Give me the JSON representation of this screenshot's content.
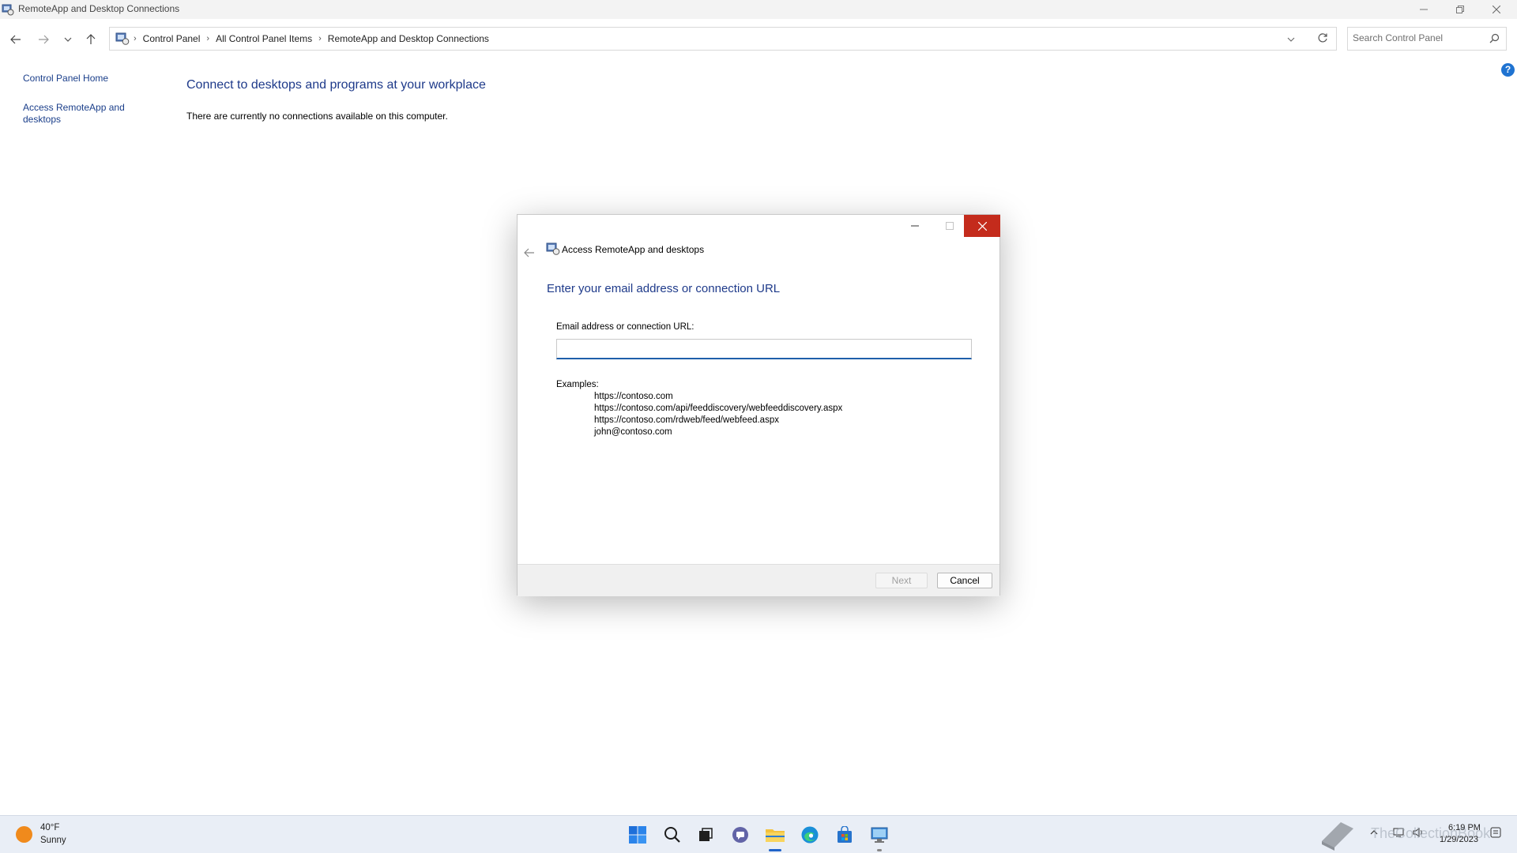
{
  "window": {
    "title": "RemoteApp and Desktop Connections"
  },
  "address": {
    "crumbs": [
      "Control Panel",
      "All Control Panel Items",
      "RemoteApp and Desktop Connections"
    ],
    "search_placeholder": "Search Control Panel"
  },
  "sidebar": {
    "items": [
      {
        "label": "Control Panel Home"
      },
      {
        "label": "Access RemoteApp and desktops"
      }
    ]
  },
  "main": {
    "heading": "Connect to desktops and programs at your workplace",
    "info": "There are currently no connections available on this computer.",
    "help_label": "?"
  },
  "dialog": {
    "title": "Access RemoteApp and desktops",
    "heading": "Enter your email address or connection URL",
    "field_label": "Email address or connection URL:",
    "field_value": "",
    "examples_label": "Examples:",
    "examples": [
      "https://contoso.com",
      "https://contoso.com/api/feeddiscovery/webfeeddiscovery.aspx",
      "https://contoso.com/rdweb/feed/webfeed.aspx",
      "john@contoso.com"
    ],
    "next_label": "Next",
    "cancel_label": "Cancel"
  },
  "taskbar": {
    "weather": {
      "temp": "40°F",
      "condition": "Sunny"
    },
    "icons": [
      "start-icon",
      "search-icon",
      "task-view-icon",
      "chat-icon",
      "file-explorer-icon",
      "edge-icon",
      "store-icon",
      "remote-desktop-icon"
    ],
    "clock": {
      "time": "6:19 PM",
      "date": "1/29/2023"
    },
    "watermark": "TheCollectionBook"
  },
  "colors": {
    "link": "#1a3e8a",
    "heading": "#1e3a8a",
    "close_red": "#c42b1c",
    "taskbar": "#e9eef6",
    "accent": "#1f63c9"
  }
}
